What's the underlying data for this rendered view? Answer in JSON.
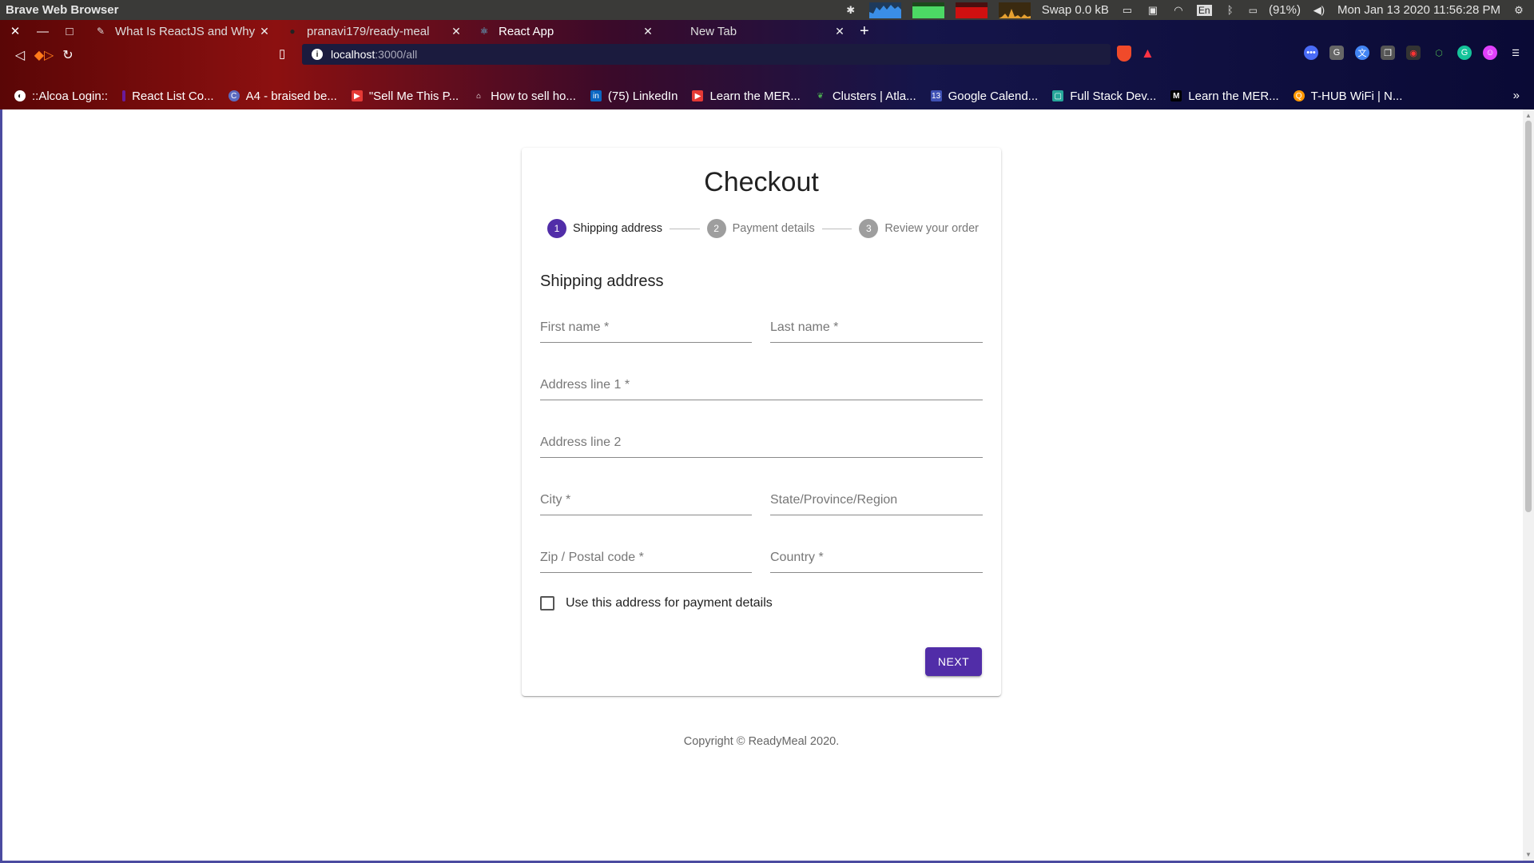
{
  "os_panel": {
    "app_title": "Brave Web Browser",
    "swap": "Swap 0.0 kB",
    "keyboard": "En",
    "battery": "(91%)",
    "datetime": "Mon Jan 13 2020 11:56:28 PM"
  },
  "tabs": [
    {
      "label": "What Is ReactJS and Why S",
      "active": false
    },
    {
      "label": "pranavi179/ready-meal",
      "active": false
    },
    {
      "label": "React App",
      "active": true
    },
    {
      "label": "New Tab",
      "active": false
    }
  ],
  "address_bar": {
    "host": "localhost",
    "path": ":3000/all"
  },
  "bookmarks": [
    {
      "label": "::Alcoa Login::",
      "icon_color": "#ffffff"
    },
    {
      "label": "React List Co...",
      "icon_color": "#6a1b9a"
    },
    {
      "label": "A4 - braised be...",
      "icon_color": "#5c6bc0"
    },
    {
      "label": "\"Sell Me This P...",
      "icon_color": "#e53935"
    },
    {
      "label": "How to sell ho...",
      "icon_color": "#ffffff"
    },
    {
      "label": "(75) LinkedIn",
      "icon_color": "#0a66c2"
    },
    {
      "label": "Learn the MER...",
      "icon_color": "#e53935"
    },
    {
      "label": "Clusters | Atla...",
      "icon_color": "#4caf50"
    },
    {
      "label": "Google Calend...",
      "icon_color": "#3f51b5"
    },
    {
      "label": "Full Stack Dev...",
      "icon_color": "#26a69a"
    },
    {
      "label": "Learn the MER...",
      "icon_color": "#000000"
    },
    {
      "label": "T-HUB WiFi | N...",
      "icon_color": "#ff9800"
    }
  ],
  "checkout": {
    "title": "Checkout",
    "steps": [
      {
        "number": "1",
        "label": "Shipping address",
        "active": true
      },
      {
        "number": "2",
        "label": "Payment details",
        "active": false
      },
      {
        "number": "3",
        "label": "Review your order",
        "active": false
      }
    ],
    "section_title": "Shipping address",
    "fields": {
      "first_name": "First name *",
      "last_name": "Last name *",
      "address1": "Address line 1 *",
      "address2": "Address line 2",
      "city": "City *",
      "state": "State/Province/Region",
      "zip": "Zip / Postal code *",
      "country": "Country *"
    },
    "checkbox_label": "Use this address for payment details",
    "checkbox_checked": false,
    "next_label": "NEXT"
  },
  "footer": {
    "copyright": "Copyright © ReadyMeal 2020."
  },
  "colors": {
    "primary": "#512da8",
    "inactive_step": "#9e9e9e"
  }
}
